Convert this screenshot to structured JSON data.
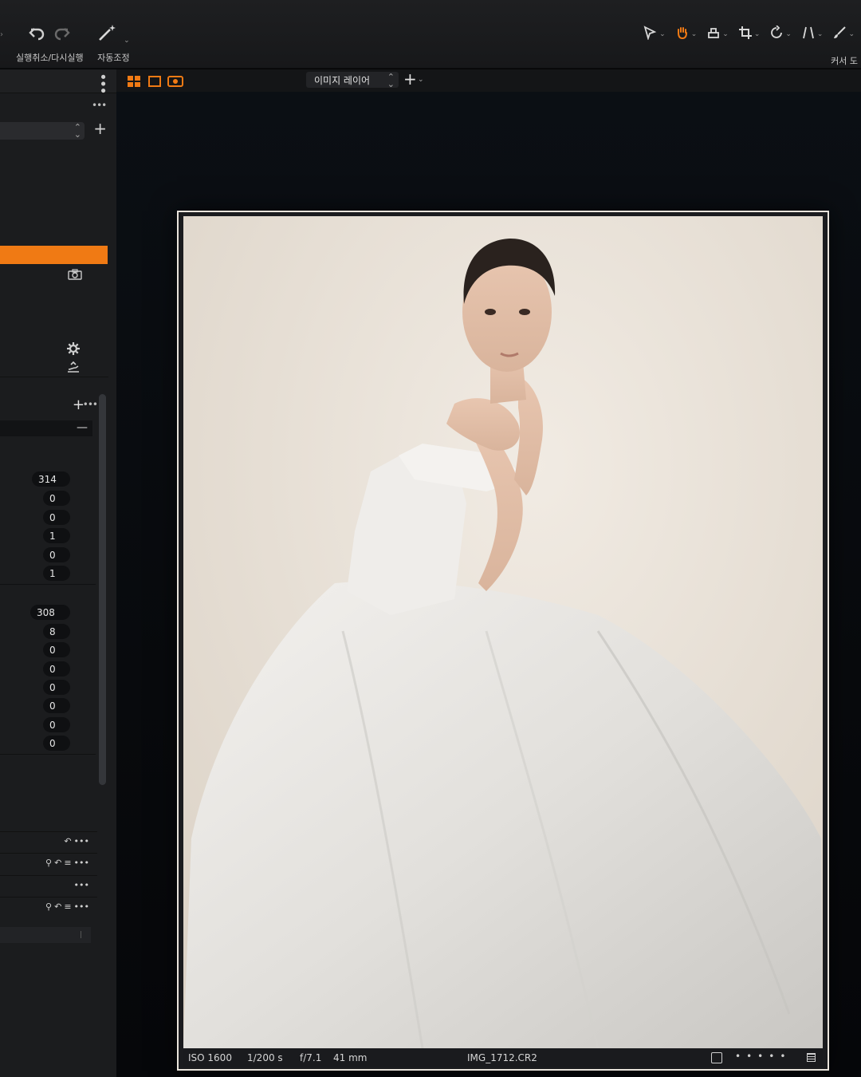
{
  "toolbar": {
    "undo_label": "실행취소/다시실행",
    "auto_adjust_label": "자동조정",
    "cursor_label": "커서 도"
  },
  "left_panel": {
    "values_group_1": [
      "314",
      "0",
      "0",
      "1",
      "0",
      "1"
    ],
    "values_group_2": [
      "308",
      "8",
      "0",
      "0",
      "0",
      "0",
      "0",
      "0"
    ]
  },
  "viewer": {
    "layer_select": "이미지 레이어",
    "info": {
      "iso": "ISO 1600",
      "shutter": "1/200 s",
      "aperture": "f/7.1",
      "focal": "41 mm",
      "filename": "IMG_1712.CR2"
    }
  },
  "colors": {
    "accent": "#f07a14",
    "panel_bg": "#1b1c1e",
    "viewer_bg": "#080a0d"
  }
}
